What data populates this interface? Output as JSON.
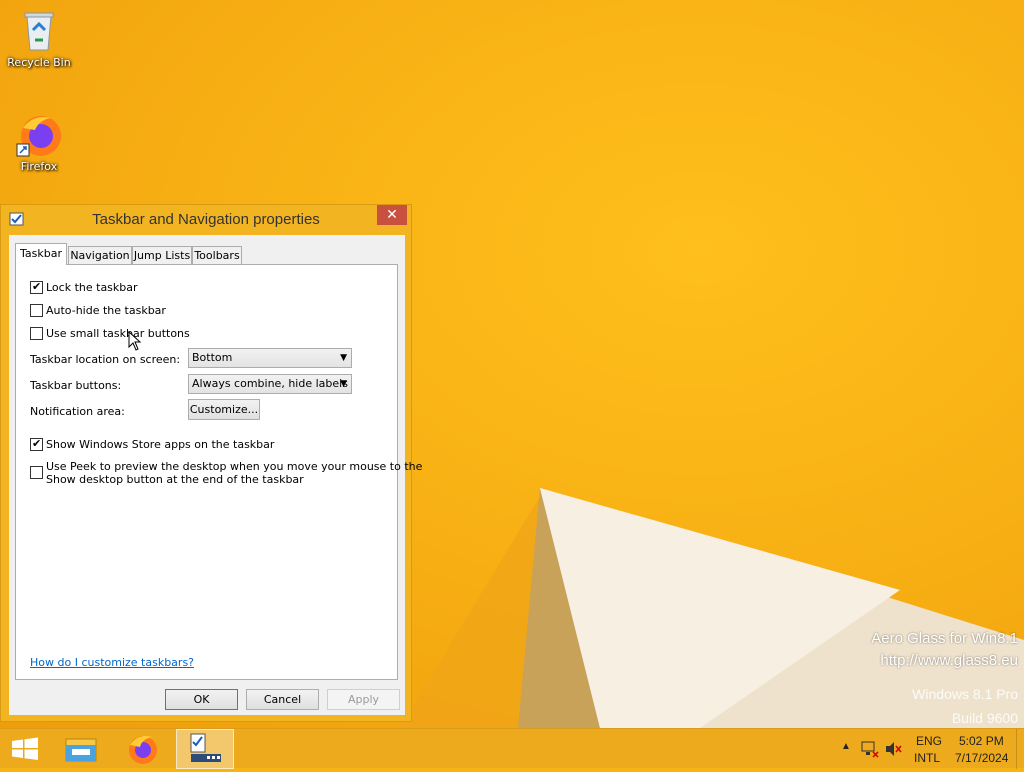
{
  "desktop": {
    "icons": [
      {
        "label": "Recycle Bin",
        "icon": "recycle-bin-icon"
      },
      {
        "label": "Firefox",
        "icon": "firefox-icon"
      }
    ],
    "watermark": {
      "line1": "Aero Glass for Win8.1",
      "line2": "http://www.glass8.eu",
      "line3": "Windows 8.1 Pro",
      "line4": "Build 9600"
    }
  },
  "dialog": {
    "title": "Taskbar and Navigation properties",
    "close_glyph": "✕",
    "tabs": [
      {
        "label": "Taskbar",
        "active": true
      },
      {
        "label": "Navigation",
        "active": false
      },
      {
        "label": "Jump Lists",
        "active": false
      },
      {
        "label": "Toolbars",
        "active": false
      }
    ],
    "options": {
      "lock": {
        "label": "Lock the taskbar",
        "checked": true
      },
      "autohide": {
        "label": "Auto-hide the taskbar",
        "checked": false
      },
      "small": {
        "label": "Use small taskbar buttons",
        "checked": false
      },
      "store": {
        "label": "Show Windows Store apps on the taskbar",
        "checked": true
      },
      "peek": {
        "label_line1": "Use Peek to preview the desktop when you move your mouse to the",
        "label_line2": "Show desktop button at the end of the taskbar",
        "checked": false
      }
    },
    "location": {
      "label": "Taskbar location on screen:",
      "value": "Bottom"
    },
    "buttons_setting": {
      "label": "Taskbar buttons:",
      "value": "Always combine, hide labels"
    },
    "notification": {
      "label": "Notification area:",
      "button": "Customize..."
    },
    "help_link": "How do I customize taskbars?",
    "footer": {
      "ok": "OK",
      "cancel": "Cancel",
      "apply": "Apply"
    }
  },
  "taskbar": {
    "items": [
      "start-button",
      "file-explorer-icon",
      "firefox-icon",
      "taskbar-properties-icon"
    ],
    "language": "ENG",
    "layout": "INTL",
    "time": "5:02 PM",
    "date": "7/17/2024"
  },
  "colors": {
    "desktop": "#f7b515",
    "dialog_frame": "#f3b422",
    "close_button": "#c7503f",
    "link": "#0066cc"
  }
}
